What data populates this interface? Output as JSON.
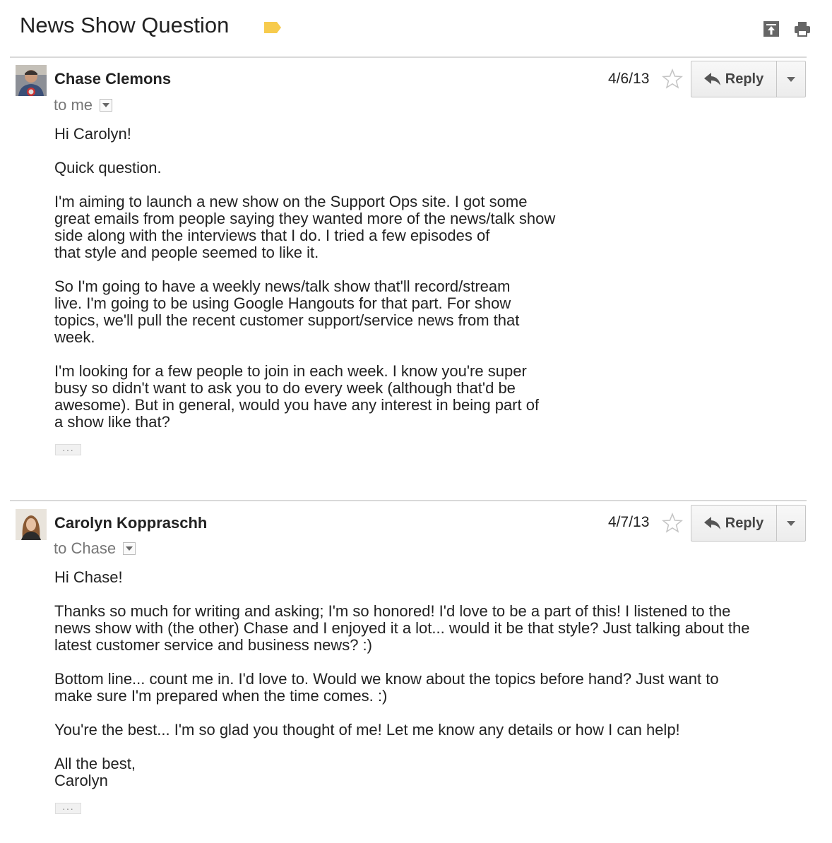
{
  "thread": {
    "subject": "News Show Question",
    "label_color": "#f7cb4d"
  },
  "messages": [
    {
      "sender": "Chase Clemons",
      "recipient": "to me",
      "date": "4/6/13",
      "reply_label": "Reply",
      "paragraphs": [
        "Hi Carolyn!",
        "Quick question.",
        "I'm aiming to launch a new show on the Support Ops site. I got some\ngreat emails from people saying they wanted more of the news/talk show\nside along with the interviews that I do. I tried a few episodes of\nthat style and people seemed to like it.",
        "So I'm going to have a weekly news/talk show that'll record/stream\nlive. I'm going to be using Google Hangouts for that part. For show\ntopics, we'll pull the recent customer support/service news from that\nweek.",
        "I'm looking for a few people to join in each week. I know you're super\nbusy so didn't want to ask you to do every week (although that'd be\nawesome). But in general, would you have any interest in being part of\na show like that?"
      ]
    },
    {
      "sender": "Carolyn Koppraschh",
      "recipient": "to Chase",
      "date": "4/7/13",
      "reply_label": "Reply",
      "paragraphs": [
        "Hi Chase!",
        "Thanks so much for writing and asking; I'm so honored! I'd love to be a part of this! I listened to the\nnews show with (the other) Chase and I enjoyed it a lot... would it be that style? Just talking about the\nlatest customer service and business news? :)",
        "Bottom line... count me in. I'd love to. Would we know about the topics before hand? Just want to\nmake sure I'm prepared when the time comes. :)",
        "You're the best... I'm so glad you thought of me! Let me know any details or how I can help!",
        "All the best,\nCarolyn"
      ]
    }
  ]
}
